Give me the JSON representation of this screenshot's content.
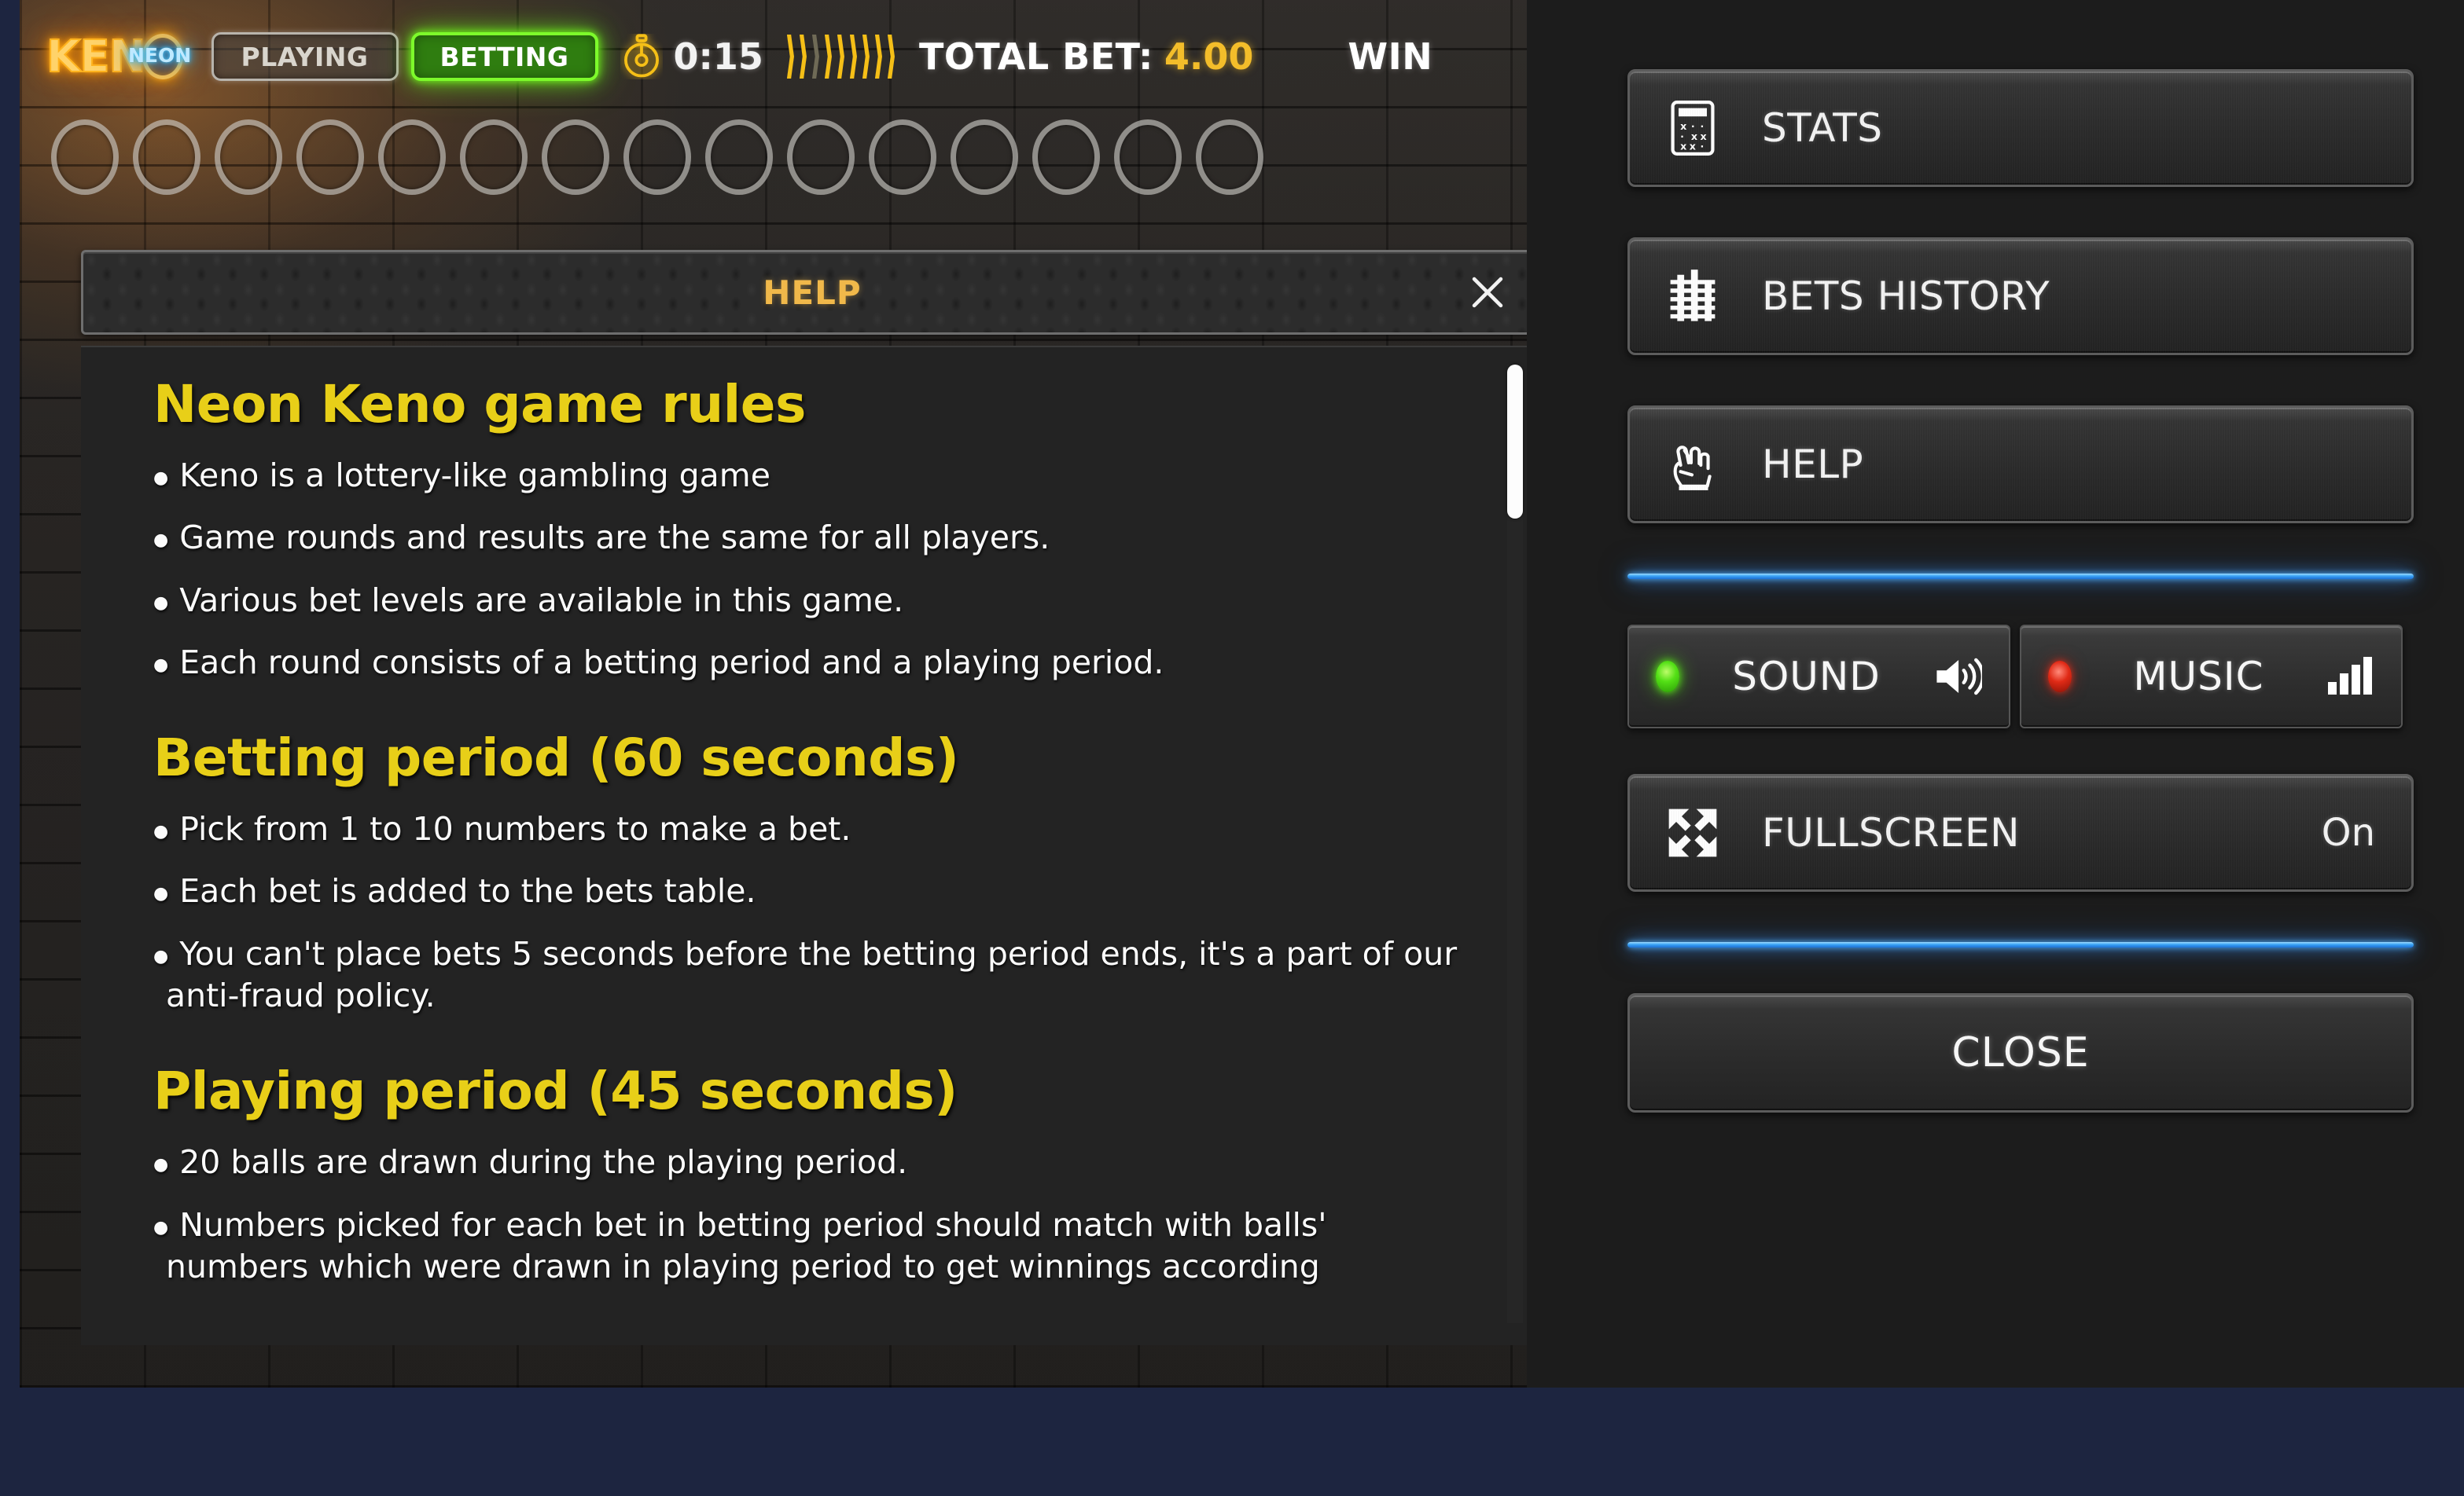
{
  "app": {
    "title": "Neon Keno",
    "background_color": "#1d2540",
    "stage_color": "#1f1d1b",
    "sidebar_color": "#1c1c1c"
  },
  "hud": {
    "logo": {
      "main_text": "KEN",
      "sub_text": "NEON",
      "o_icon": "neon-ring-icon",
      "main_color": "#ffc44d",
      "sub_color": "#49c8ff"
    },
    "state_pills": [
      {
        "name": "playing",
        "label": "PLAYING",
        "active": false,
        "color": "#b9b5ad"
      },
      {
        "name": "betting",
        "label": "BETTING",
        "active": true,
        "color": "#7dfb2b"
      }
    ],
    "timer": {
      "icon": "stopwatch-icon",
      "value": "0:15",
      "chevron_count": 9,
      "chevron_color": "#f5bf17"
    },
    "total_bet": {
      "label": "TOTAL BET:",
      "value": "4.00",
      "value_color": "#f3bd2a"
    },
    "win": {
      "label": "WIN"
    }
  },
  "ball_row": {
    "slot_count": 15,
    "filled": []
  },
  "help_modal": {
    "title": "HELP",
    "title_color": "#f0b84a",
    "close_icon": "close-icon",
    "scrollbar": {
      "thumb_position_pct": 2,
      "thumb_size_pct": 16
    },
    "sections": [
      {
        "heading": "Neon Keno game rules",
        "items": [
          "Keno is a lottery-like gambling game",
          "Game rounds and results are the same for all players.",
          "Various bet levels are available in this game.",
          "Each round consists of a betting period and a playing period."
        ]
      },
      {
        "heading": "Betting period (60 seconds)",
        "items": [
          "Pick from 1 to 10 numbers to make a bet.",
          "Each bet is added to the bets table.",
          "You can't place bets 5 seconds before the betting period ends, it's a part of our anti-fraud policy."
        ]
      },
      {
        "heading": "Playing period (45 seconds)",
        "items": [
          "20 balls are drawn during the playing period.",
          "Numbers picked for each bet in betting period should match with balls' numbers which were drawn in playing period to get winnings according"
        ]
      }
    ],
    "heading_color": "#e8cf18"
  },
  "sidebar": {
    "buttons": [
      {
        "name": "stats",
        "label": "STATS",
        "icon": "calculator-icon"
      },
      {
        "name": "bets-history",
        "label": "BETS HISTORY",
        "icon": "bets-chart-icon"
      },
      {
        "name": "help",
        "label": "HELP",
        "icon": "crossed-fingers-icon"
      }
    ],
    "toggles": [
      {
        "name": "sound",
        "label": "SOUND",
        "state": "on",
        "led_color": "#54e016",
        "icon": "speaker-icon"
      },
      {
        "name": "music",
        "label": "MUSIC",
        "state": "off",
        "led_color": "#e02a16",
        "icon": "equalizer-icon"
      }
    ],
    "fullscreen": {
      "label": "FULLSCREEN",
      "value": "On",
      "icon": "expand-arrows-icon"
    },
    "close": {
      "label": "CLOSE"
    },
    "divider_color": "#3aa3f5"
  }
}
